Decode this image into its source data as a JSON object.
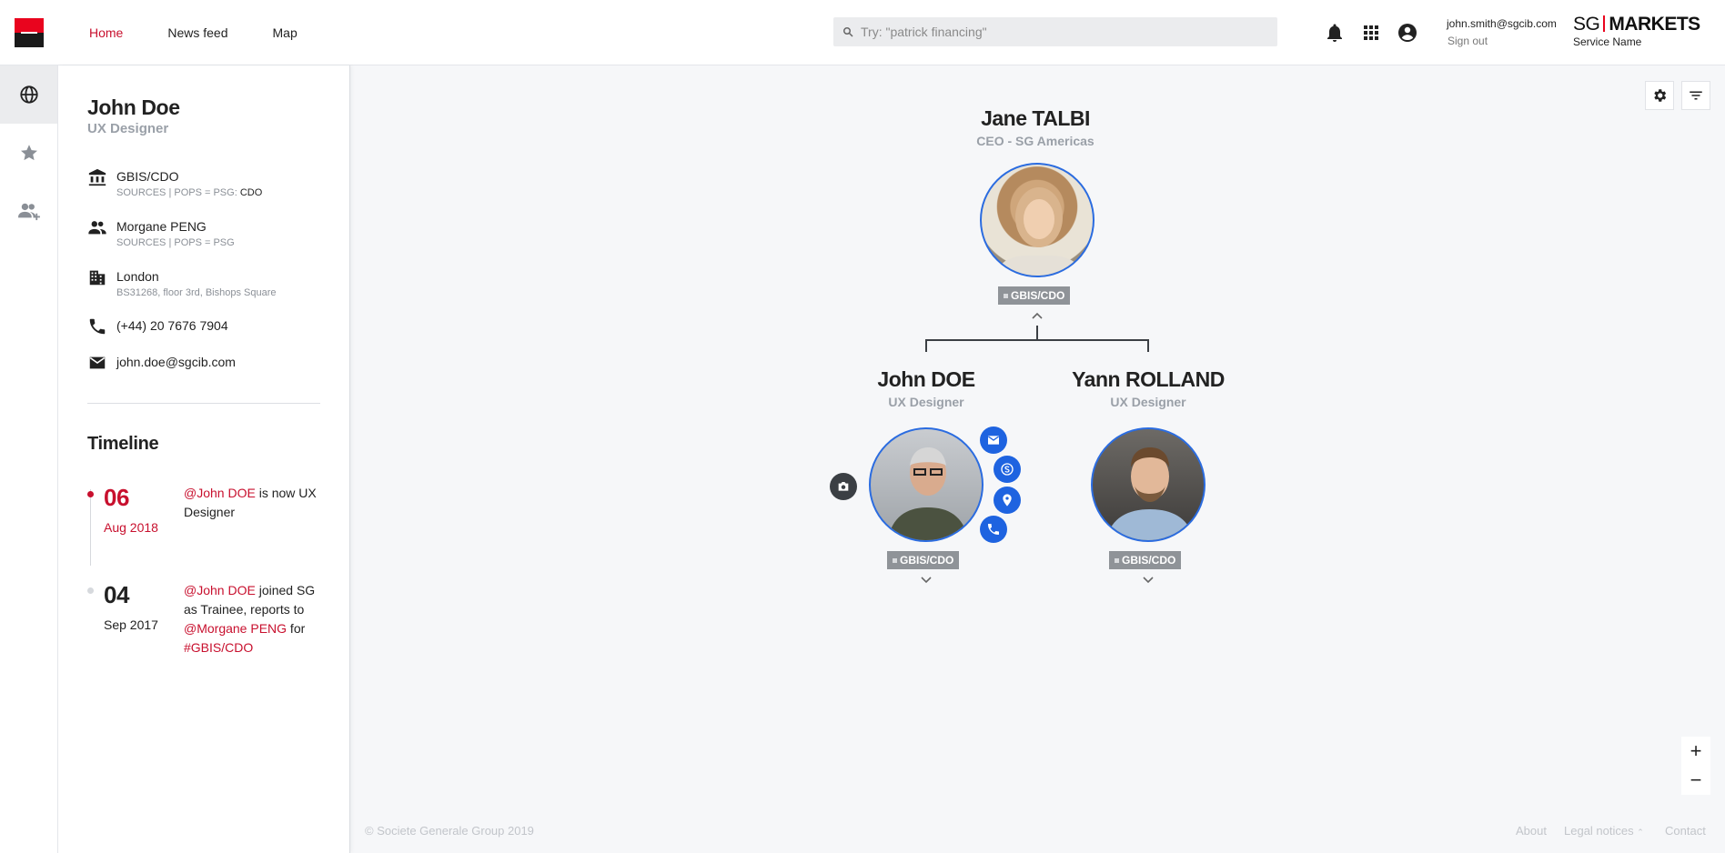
{
  "header": {
    "nav": [
      "Home",
      "News feed",
      "Map"
    ],
    "search_placeholder": "Try: \"patrick financing\"",
    "user_email": "john.smith@sgcib.com",
    "sign_out": "Sign out",
    "brand_left": "SG",
    "brand_right": "MARKETS",
    "service_name": "Service Name"
  },
  "profile": {
    "name": "John Doe",
    "role": "UX Designer",
    "department": "GBIS/CDO",
    "department_sub": "SOURCES | POPS = PSG: ",
    "department_sub_code": "CDO",
    "manager": "Morgane PENG",
    "manager_sub": "SOURCES | POPS = PSG",
    "city": "London",
    "address": "BS31268, floor 3rd, Bishops Square",
    "phone": "(+44) 20 7676 7904",
    "email": "john.doe@sgcib.com"
  },
  "timeline": {
    "title": "Timeline",
    "events": [
      {
        "day": "06",
        "month": "Aug 2018",
        "mention": "@John DOE",
        "text": " is now UX Designer"
      },
      {
        "day": "04",
        "month": "Sep 2017",
        "mention": "@John DOE",
        "text1": " joined SG as  Trainee, reports to ",
        "mention2": "@Morgane PENG",
        "text2": " for ",
        "mention3": "#GBIS/CDO"
      }
    ]
  },
  "org": {
    "top": {
      "name": "Jane TALBI",
      "role": "CEO - SG Americas",
      "tag": "GBIS/CDO"
    },
    "left": {
      "name": "John DOE",
      "role": "UX Designer",
      "tag": "GBIS/CDO"
    },
    "right": {
      "name": "Yann ROLLAND",
      "role": "UX Designer",
      "tag": "GBIS/CDO"
    }
  },
  "zoom": {
    "in": "+",
    "out": "−"
  },
  "footer": {
    "copyright": "© Societe Generale Group 2019",
    "about": "About",
    "legal": "Legal notices",
    "contact": "Contact"
  },
  "colors": {
    "accent": "#c8102e",
    "brand_red": "#e9041e",
    "action_blue": "#1e63e0"
  }
}
